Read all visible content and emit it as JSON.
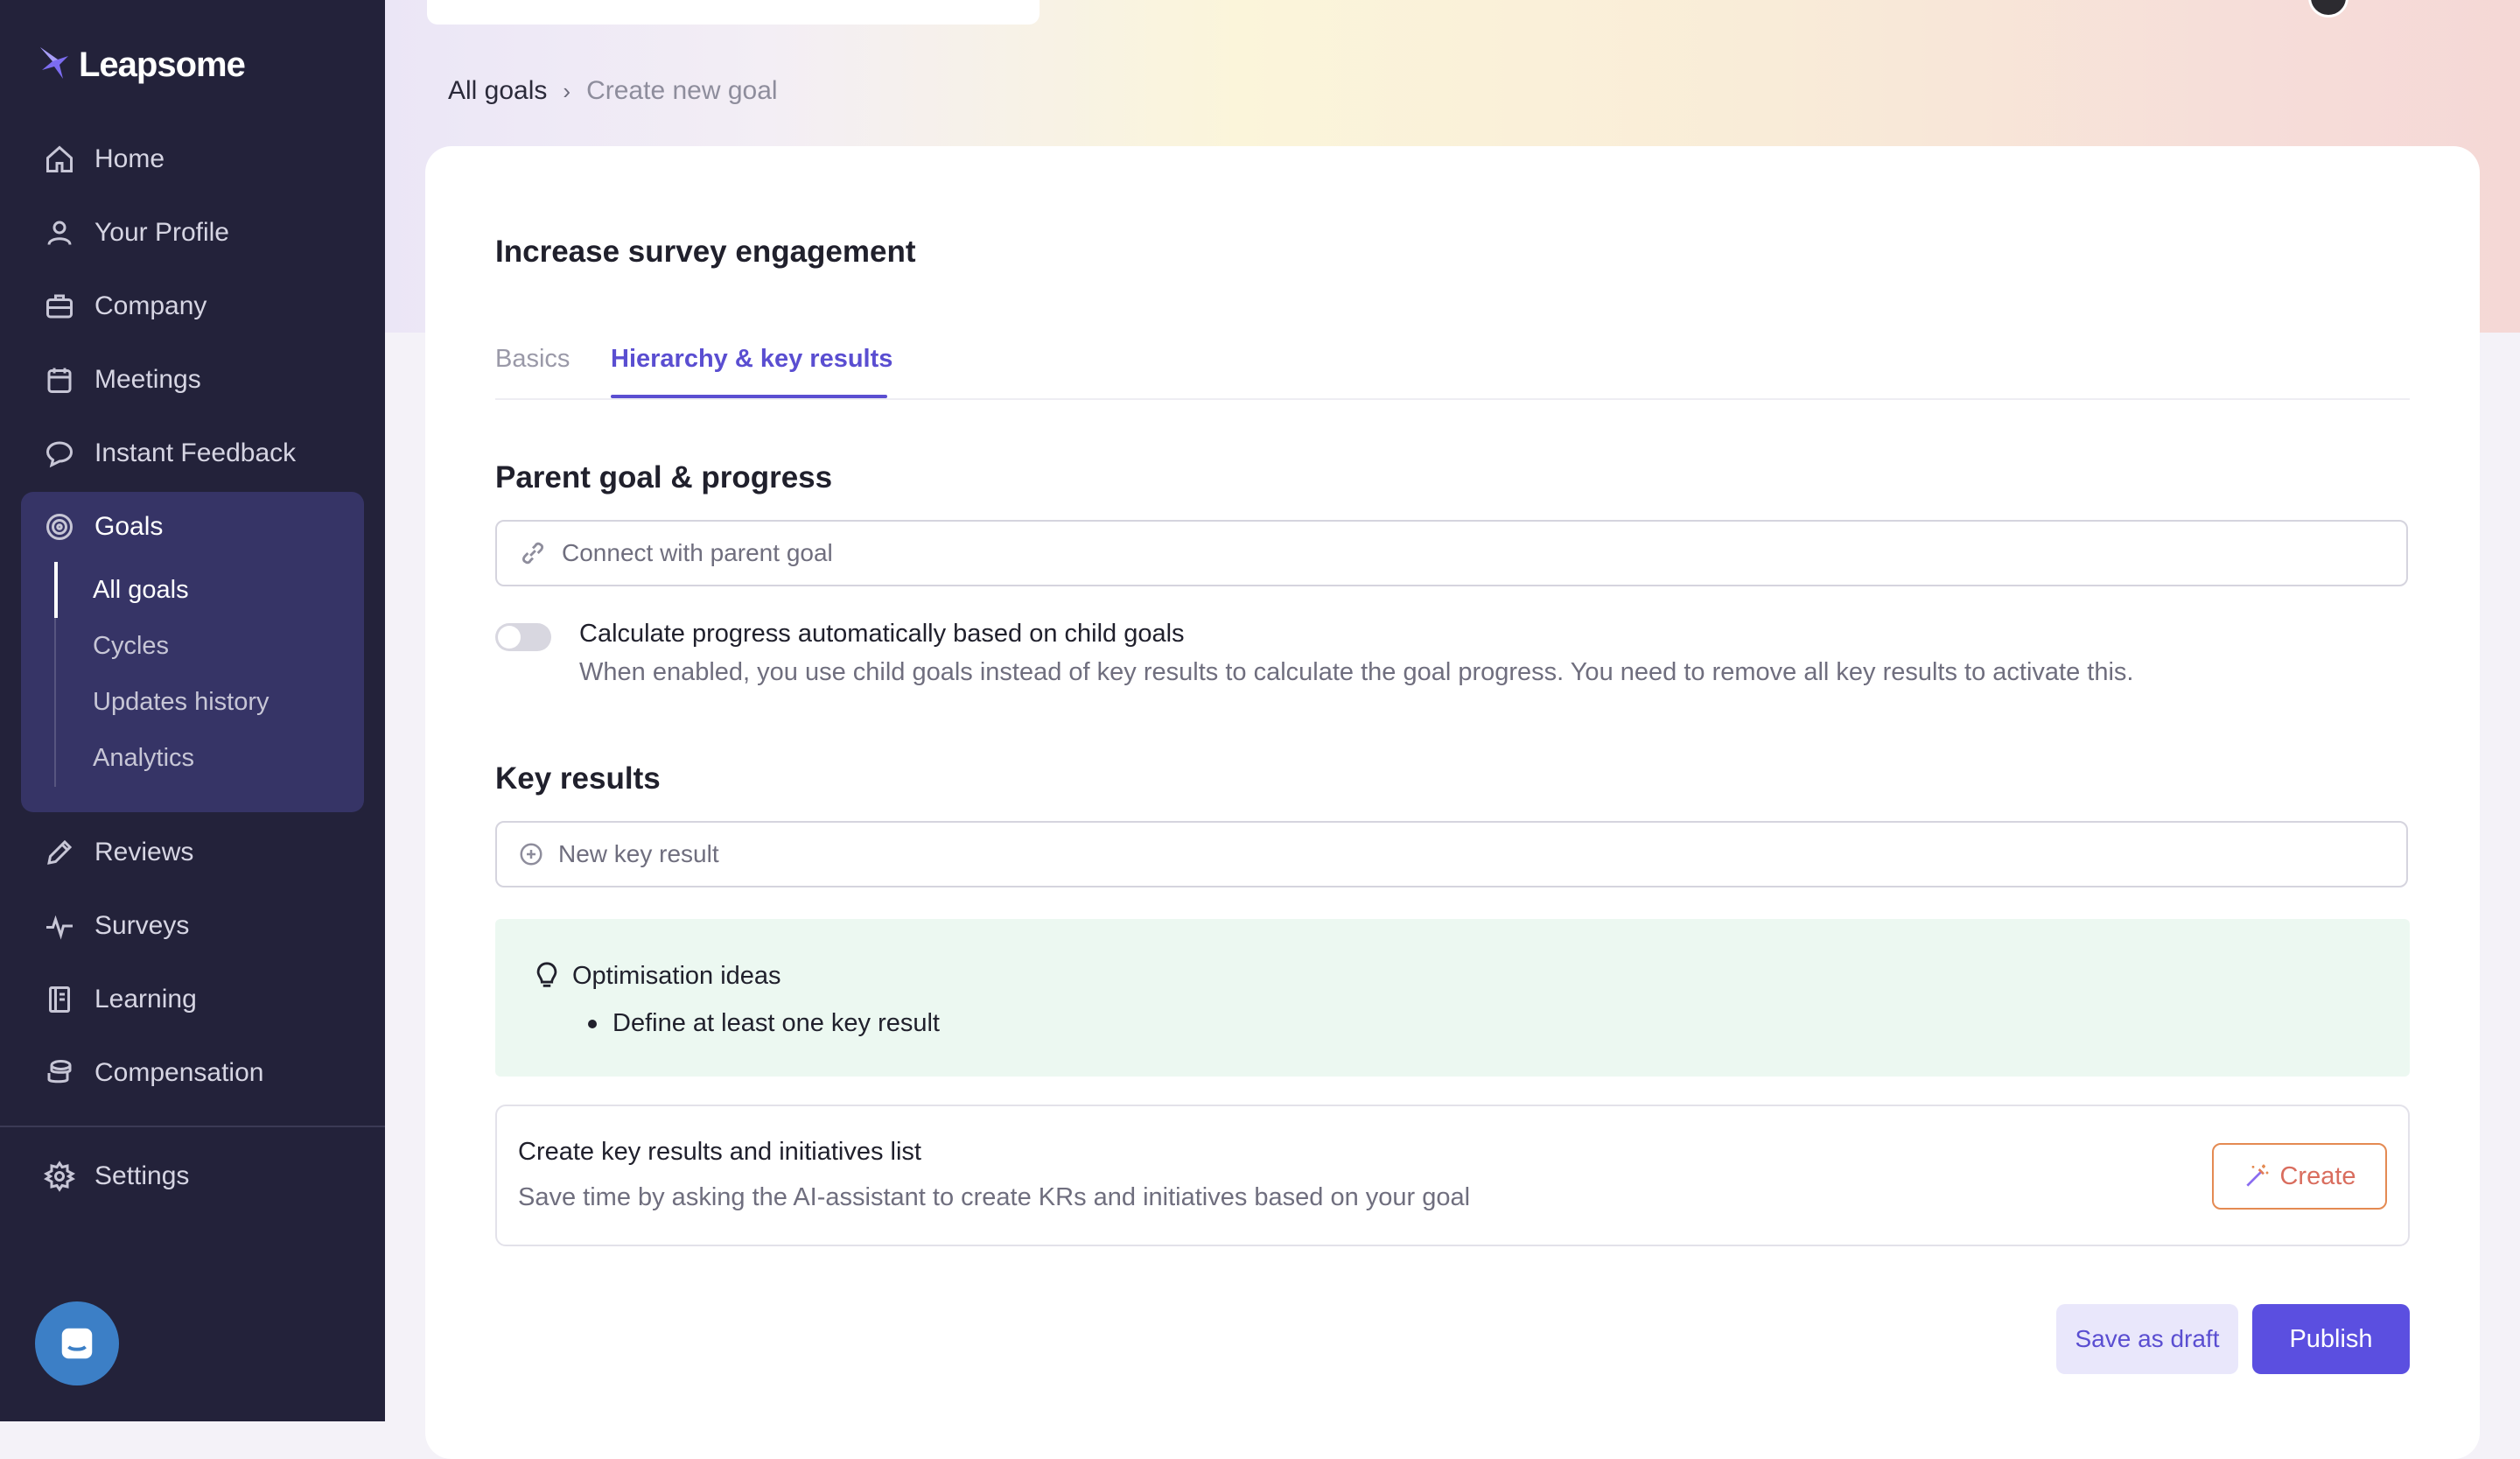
{
  "app": {
    "brand": "Leapsome"
  },
  "sidebar": {
    "items": [
      {
        "label": "Home",
        "icon": "home-icon"
      },
      {
        "label": "Your Profile",
        "icon": "user-icon"
      },
      {
        "label": "Company",
        "icon": "briefcase-icon"
      },
      {
        "label": "Meetings",
        "icon": "calendar-icon"
      },
      {
        "label": "Instant Feedback",
        "icon": "chat-icon"
      },
      {
        "label": "Goals",
        "icon": "target-icon"
      },
      {
        "label": "Reviews",
        "icon": "pencil-icon"
      },
      {
        "label": "Surveys",
        "icon": "pulse-icon"
      },
      {
        "label": "Learning",
        "icon": "book-icon"
      },
      {
        "label": "Compensation",
        "icon": "coins-icon"
      },
      {
        "label": "Settings",
        "icon": "gear-icon"
      }
    ],
    "goals_sub": [
      {
        "label": "All goals",
        "active": true
      },
      {
        "label": "Cycles"
      },
      {
        "label": "Updates history"
      },
      {
        "label": "Analytics"
      }
    ]
  },
  "breadcrumb": {
    "parent": "All goals",
    "current": "Create new goal"
  },
  "goal": {
    "title": "Increase survey engagement"
  },
  "tabs": [
    {
      "label": "Basics",
      "active": false
    },
    {
      "label": "Hierarchy & key results",
      "active": true
    }
  ],
  "parent_section": {
    "title": "Parent goal & progress",
    "placeholder": "Connect with parent goal",
    "toggle_label": "Calculate progress automatically based on child goals",
    "toggle_desc": "When enabled, you use child goals instead of key results to calculate the goal progress. You need to remove all key results to activate this.",
    "toggle_on": false
  },
  "key_results": {
    "title": "Key results",
    "placeholder": "New key result"
  },
  "ideas": {
    "title": "Optimisation ideas",
    "items": [
      "Define at least one key result"
    ]
  },
  "ai_assist": {
    "title": "Create key results and initiatives list",
    "desc": "Save time by asking the AI-assistant to create KRs and initiatives based on your goal",
    "button": "Create"
  },
  "actions": {
    "draft": "Save as draft",
    "publish": "Publish"
  },
  "colors": {
    "accent": "#5b4fe0",
    "sidebar": "#23223a",
    "ideas_bg": "#ecf8f1",
    "ai_orange": "#e48a52"
  }
}
